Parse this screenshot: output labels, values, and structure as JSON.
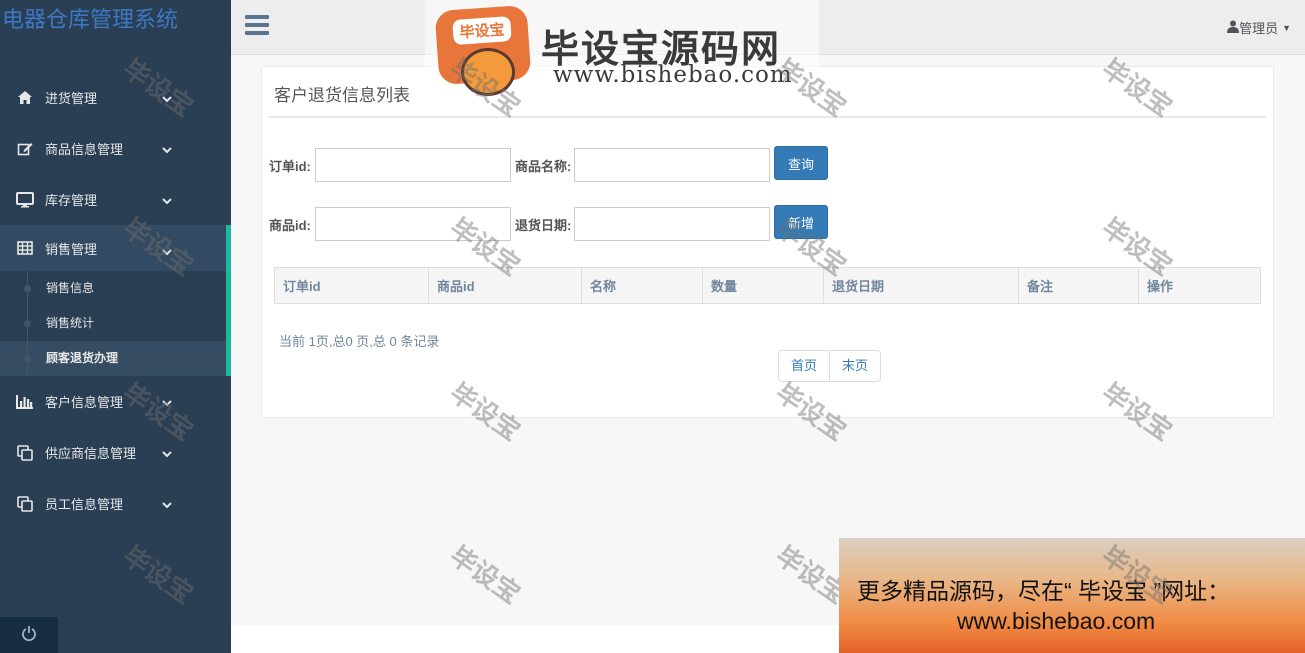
{
  "app": {
    "title": "电器仓库管理系统"
  },
  "sidebar": {
    "items": [
      {
        "label": "进货管理",
        "icon": "home-icon"
      },
      {
        "label": "商品信息管理",
        "icon": "edit-icon"
      },
      {
        "label": "库存管理",
        "icon": "desktop-icon"
      },
      {
        "label": "销售管理",
        "icon": "table-icon",
        "expanded": true,
        "sub": [
          {
            "label": "销售信息"
          },
          {
            "label": "销售统计"
          },
          {
            "label": "顾客退货办理",
            "current": true
          }
        ]
      },
      {
        "label": "客户信息管理",
        "icon": "bar-chart-icon"
      },
      {
        "label": "供应商信息管理",
        "icon": "clone-icon"
      },
      {
        "label": "员工信息管理",
        "icon": "clone-icon"
      }
    ]
  },
  "topbar": {
    "user": "管理员"
  },
  "panel": {
    "title": "客户退货信息列表",
    "search": {
      "order_id_label": "订单id:",
      "product_name_label": "商品名称:",
      "query_button": "查询",
      "product_id_label": "商品id:",
      "return_date_label": "退货日期:",
      "add_button": "新增"
    },
    "table": {
      "headers": [
        "订单id",
        "商品id",
        "名称",
        "数量",
        "退货日期",
        "备注",
        "操作"
      ],
      "rows": []
    },
    "page_info": "当前 1页,总0 页,总 0 条记录",
    "pager": {
      "first": "首页",
      "last": "末页"
    }
  },
  "watermarks": {
    "stamp": "毕设宝",
    "logo_title": "毕设宝源码网",
    "logo_url": "www.bishebao.com",
    "logo_badge": "毕设宝"
  },
  "ad": {
    "line1": "更多精品源码，尽在“ 毕设宝 ”网址：",
    "line2": "www.bishebao.com"
  },
  "colors": {
    "sidebar": "#2a3f54",
    "accent": "#1abb9c",
    "primary": "#337ab7",
    "brand": "#3d78c4"
  }
}
